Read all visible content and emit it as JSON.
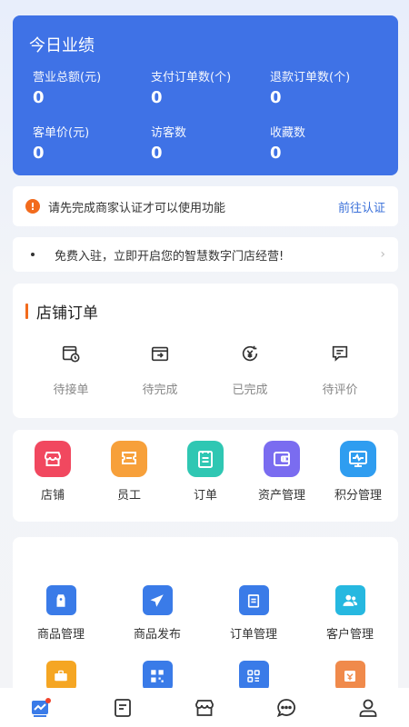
{
  "stats": {
    "title": "今日业绩",
    "items": [
      {
        "label": "营业总额(元)",
        "value": "0"
      },
      {
        "label": "支付订单数(个)",
        "value": "0"
      },
      {
        "label": "退款订单数(个)",
        "value": "0"
      },
      {
        "label": "客单价(元)",
        "value": "0"
      },
      {
        "label": "访客数",
        "value": "0"
      },
      {
        "label": "收藏数",
        "value": "0"
      }
    ],
    "bg_color": "#3f72e6"
  },
  "notice": {
    "icon": "warning-icon",
    "text": "请先完成商家认证才可以使用功能",
    "link": "前往认证",
    "link_color": "#3a70d9"
  },
  "promo": {
    "text": "免费入驻，立即开启您的智慧数字门店经营!"
  },
  "orders": {
    "title": "店铺订单",
    "accent": "#f26b1d",
    "items": [
      {
        "label": "待接单",
        "icon": "pending-order-icon"
      },
      {
        "label": "待完成",
        "icon": "in-progress-icon"
      },
      {
        "label": "已完成",
        "icon": "completed-icon"
      },
      {
        "label": "待评价",
        "icon": "review-icon"
      }
    ]
  },
  "tools": [
    {
      "label": "店铺",
      "icon": "store-icon",
      "color": "#f1485f"
    },
    {
      "label": "员工",
      "icon": "staff-icon",
      "color": "#f7a03a"
    },
    {
      "label": "订单",
      "icon": "order-icon",
      "color": "#2fc7b3"
    },
    {
      "label": "资产管理",
      "icon": "wallet-icon",
      "color": "#7a6cf0"
    },
    {
      "label": "积分管理",
      "icon": "points-icon",
      "color": "#2f9df0"
    }
  ],
  "manage": [
    {
      "label": "商品管理",
      "icon": "product-tag-icon",
      "color": "#3a7be8"
    },
    {
      "label": "商品发布",
      "icon": "send-icon",
      "color": "#3a7be8"
    },
    {
      "label": "订单管理",
      "icon": "order-list-icon",
      "color": "#3a7be8"
    },
    {
      "label": "客户管理",
      "icon": "customers-icon",
      "color": "#26b8e0"
    },
    {
      "label": "",
      "icon": "briefcase-icon",
      "color": "#f5a623"
    },
    {
      "label": "",
      "icon": "qrcode-icon",
      "color": "#3a7be8"
    },
    {
      "label": "",
      "icon": "scan-code-icon",
      "color": "#3a7be8"
    },
    {
      "label": "",
      "icon": "coupon-icon",
      "color": "#f08a4b"
    }
  ],
  "tabbar": [
    {
      "icon": "dashboard-icon",
      "active": true
    },
    {
      "icon": "document-icon",
      "active": false
    },
    {
      "icon": "shop-icon",
      "active": false
    },
    {
      "icon": "message-icon",
      "active": false
    },
    {
      "icon": "profile-icon",
      "active": false
    }
  ]
}
